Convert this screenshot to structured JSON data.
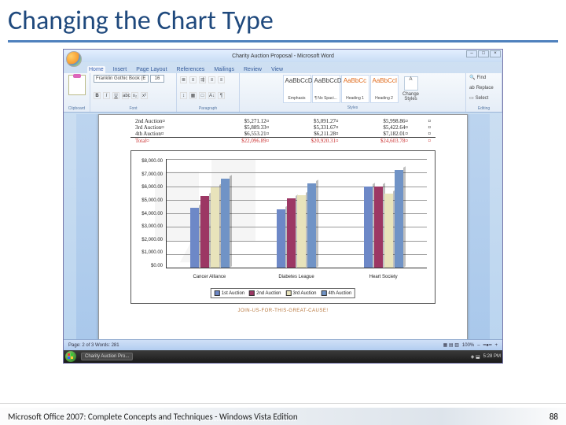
{
  "slide": {
    "title": "Changing the Chart Type",
    "footer_left": "Microsoft Office 2007: Complete Concepts and Techniques - Windows Vista Edition",
    "page_number": "88"
  },
  "word": {
    "title": "Charity Auction Proposal - Microsoft Word",
    "tabs": [
      "Home",
      "Insert",
      "Page Layout",
      "References",
      "Mailings",
      "Review",
      "View"
    ],
    "active_tab": "Home",
    "font_name": "Franklin Gothic Book (E",
    "font_size": "16",
    "groups": {
      "clipboard": "Clipboard",
      "font": "Font",
      "paragraph": "Paragraph",
      "styles": "Styles",
      "editing": "Editing"
    },
    "style_tiles": [
      {
        "sample": "AaBbCcD",
        "name": "Emphasis",
        "cls": ""
      },
      {
        "sample": "AaBbCcD",
        "name": "¶ No Spaci...",
        "cls": ""
      },
      {
        "sample": "AaBbCc",
        "name": "Heading 1",
        "cls": "orange"
      },
      {
        "sample": "AaBbCcI",
        "name": "Heading 2",
        "cls": "orange"
      }
    ],
    "change_styles": "Change Styles",
    "editing_items": [
      "Find",
      "Replace",
      "Select"
    ],
    "status_left": "Page: 2 of 3    Words: 281",
    "zoom": "100%",
    "zoom_minus": "–",
    "zoom_plus": "+"
  },
  "doc": {
    "table_rows": [
      {
        "label": "2nd Auction¤",
        "a": "$5,271.12¤",
        "b": "$5,091.27¤",
        "c": "$5,998.86¤"
      },
      {
        "label": "3rd Auction¤",
        "a": "$5,889.33¤",
        "b": "$5,331.67¤",
        "c": "$5,422.64¤"
      },
      {
        "label": "4th Auction¤",
        "a": "$6,553.21¤",
        "b": "$6,211.28¤",
        "c": "$7,182.01¤"
      }
    ],
    "total_row": {
      "label": "Total¤",
      "a": "$22,096.89¤",
      "b": "$20,920.31¤",
      "c": "$24,603.78¤"
    },
    "footer_text": "JOIN-US-FOR-THIS-GREAT-CAUSE!"
  },
  "chart_data": {
    "type": "bar",
    "categories": [
      "Cancer Alliance",
      "Diabetes League",
      "Heart Society"
    ],
    "series": [
      {
        "name": "1st Auction",
        "values": [
          4400,
          4300,
          6000
        ]
      },
      {
        "name": "2nd Auction",
        "values": [
          5271,
          5091,
          5999
        ]
      },
      {
        "name": "3rd Auction",
        "values": [
          5889,
          5332,
          5423
        ]
      },
      {
        "name": "4th Auction",
        "values": [
          6553,
          6211,
          7182
        ]
      }
    ],
    "ylim": [
      0,
      8000
    ],
    "yticks": [
      "$8,000.00",
      "$7,000.00",
      "$6,000.00",
      "$5,000.00",
      "$4,000.00",
      "$3,000.00",
      "$2,000.00",
      "$1,000.00",
      "$0.00"
    ],
    "legend": [
      "1st Auction",
      "2nd Auction",
      "3rd Auction",
      "4th Auction"
    ]
  },
  "taskbar": {
    "app": "Charity Auction Pro...",
    "time": "5:28 PM"
  }
}
